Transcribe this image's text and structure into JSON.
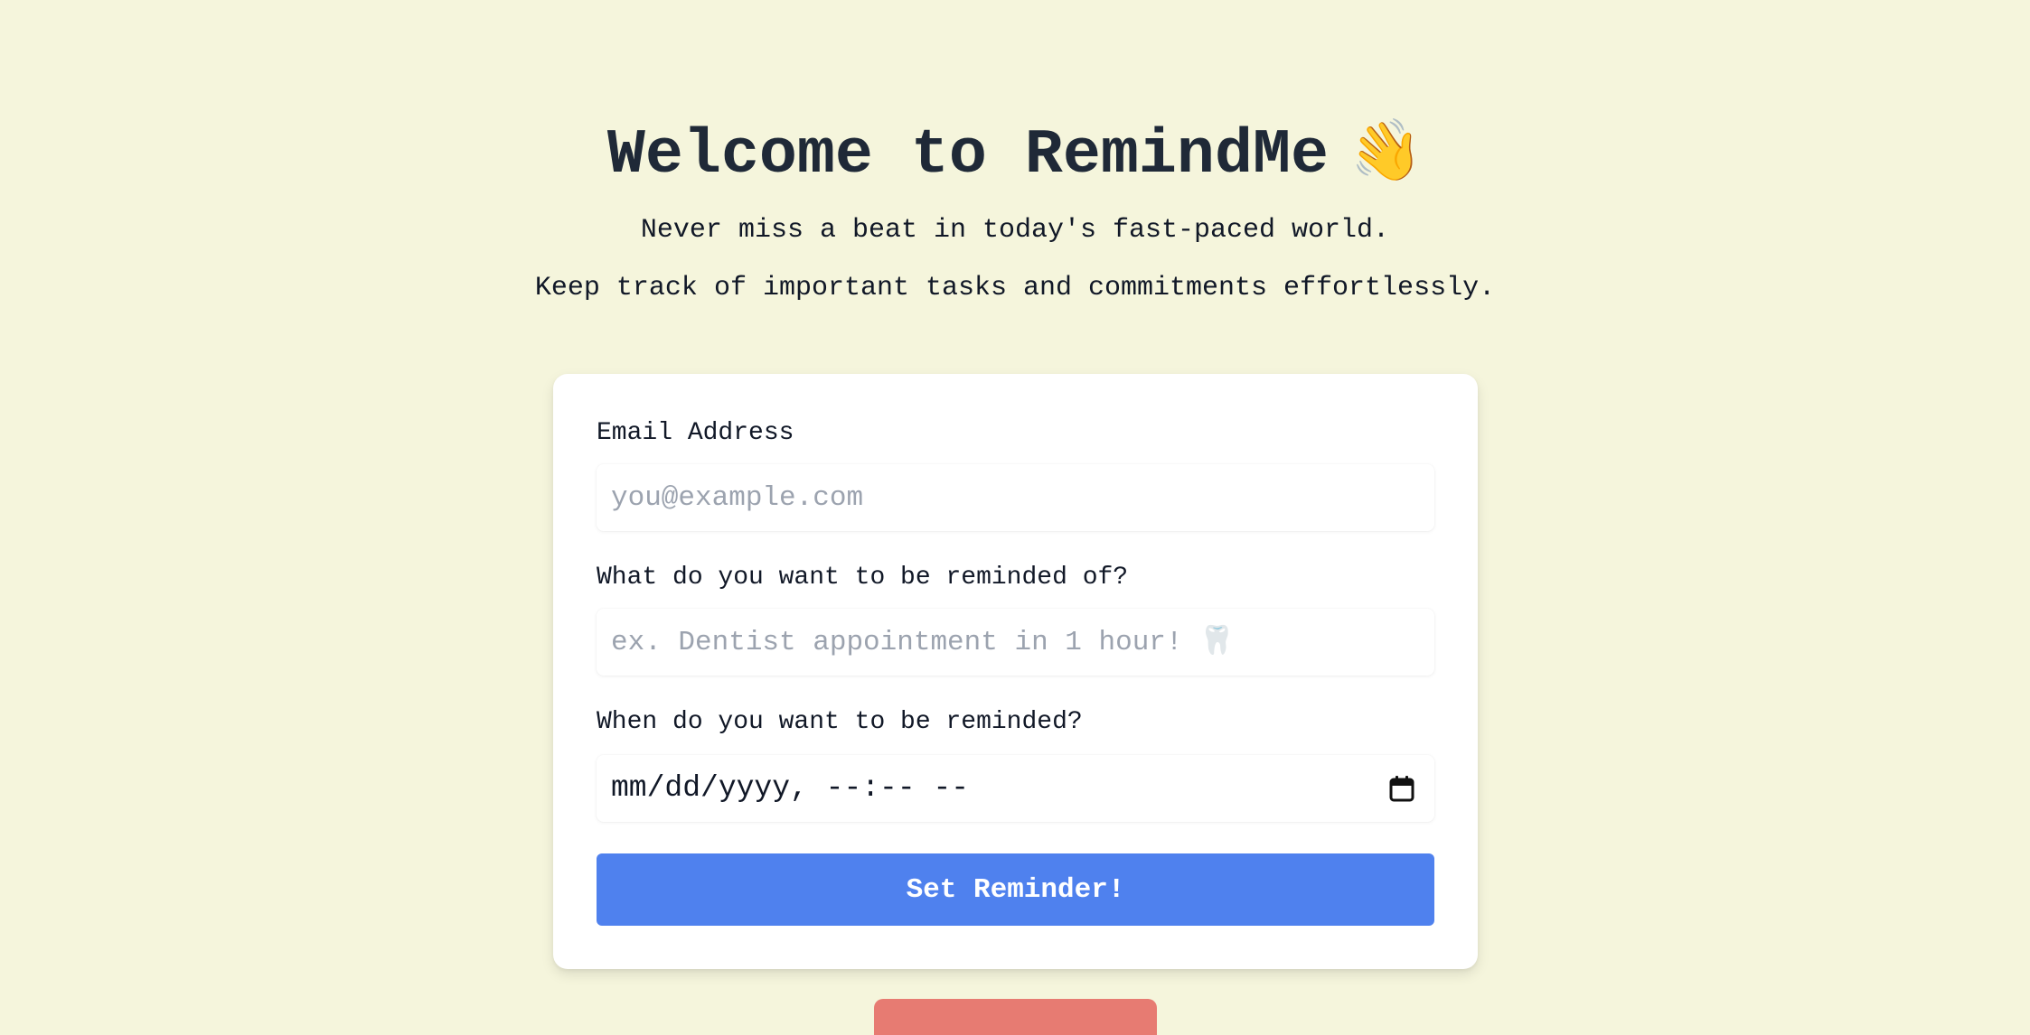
{
  "hero": {
    "title": "Welcome to RemindMe",
    "title_emoji": "👋",
    "subtitle_1": "Never miss a beat in today's fast-paced world.",
    "subtitle_2": "Keep track of important tasks and commitments effortlessly."
  },
  "form": {
    "email": {
      "label": "Email Address",
      "value": "",
      "placeholder": "you@example.com"
    },
    "reminder": {
      "label": "What do you want to be reminded of?",
      "value": "",
      "placeholder": "ex. Dentist appointment in 1 hour! 🦷"
    },
    "when": {
      "label": "When do you want to be reminded?",
      "display_value": "mm/dd/yyyy, --:-- --",
      "icon": "calendar-icon"
    },
    "submit_label": "Set Reminder!"
  },
  "colors": {
    "background": "#f5f5dc",
    "primary": "#4f81ee",
    "secondary": "#e77b72",
    "text": "#1f2937",
    "placeholder": "#9ca3af"
  }
}
